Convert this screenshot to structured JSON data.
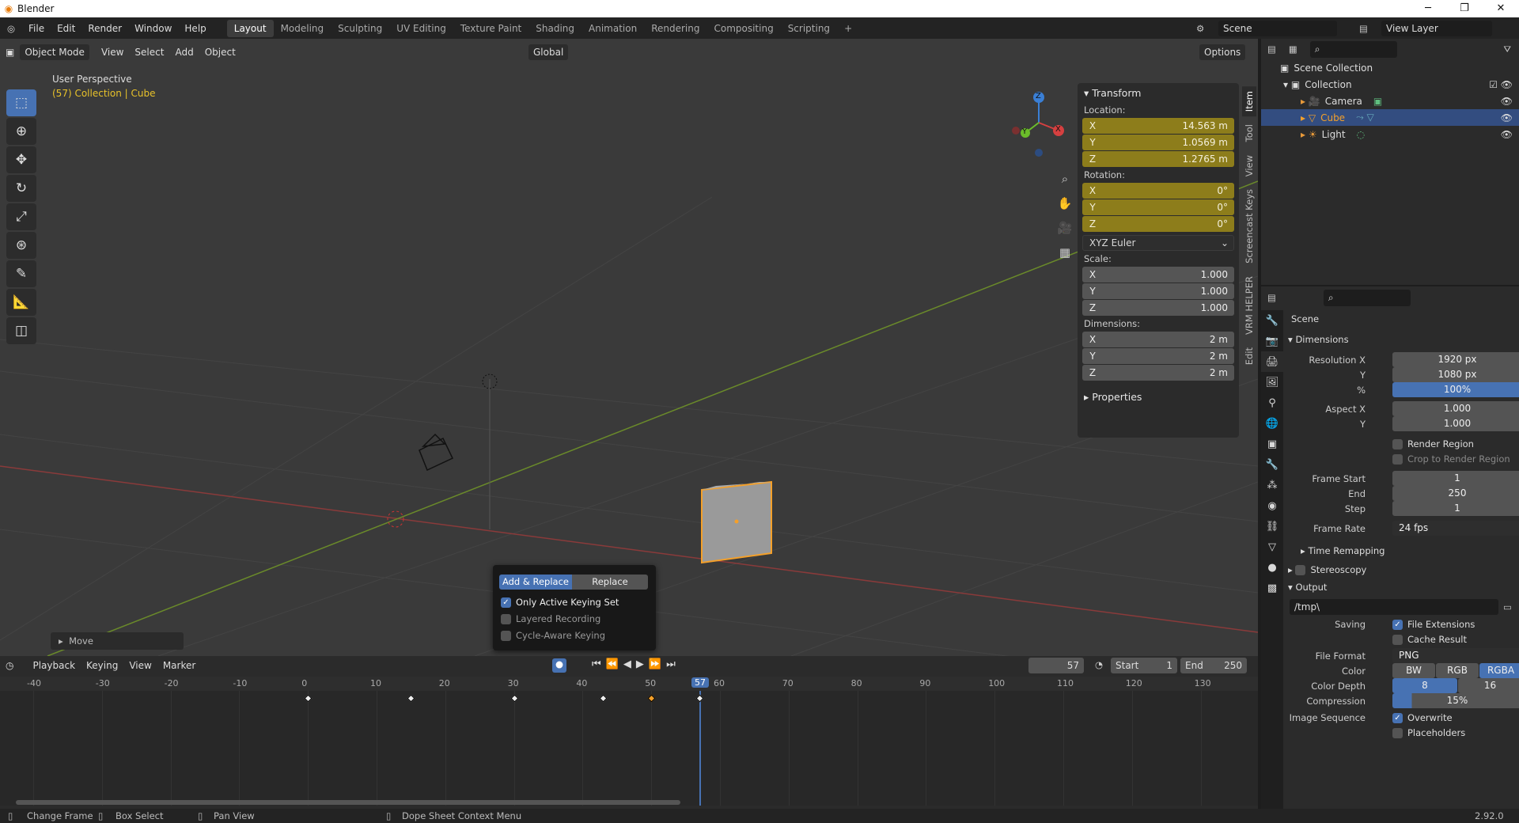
{
  "window": {
    "title": "Blender"
  },
  "menu": [
    "File",
    "Edit",
    "Render",
    "Window",
    "Help"
  ],
  "workspaces": [
    "Layout",
    "Modeling",
    "Sculpting",
    "UV Editing",
    "Texture Paint",
    "Shading",
    "Animation",
    "Rendering",
    "Compositing",
    "Scripting"
  ],
  "active_workspace": "Layout",
  "scene_field": "Scene",
  "view_layer_field": "View Layer",
  "viewport": {
    "mode": "Object Mode",
    "menus": [
      "View",
      "Select",
      "Add",
      "Object"
    ],
    "orientation": "Global",
    "options": "Options",
    "info_line1": "User Perspective",
    "info_line2": "(57) Collection | Cube",
    "move_panel": "Move",
    "gizmo_axes": {
      "x": "X",
      "y": "Y",
      "z": "Z"
    }
  },
  "npanel": {
    "header": "Transform",
    "location_label": "Location:",
    "location": [
      {
        "axis": "X",
        "value": "14.563 m"
      },
      {
        "axis": "Y",
        "value": "1.0569 m"
      },
      {
        "axis": "Z",
        "value": "1.2765 m"
      }
    ],
    "rotation_label": "Rotation:",
    "rotation": [
      {
        "axis": "X",
        "value": "0°"
      },
      {
        "axis": "Y",
        "value": "0°"
      },
      {
        "axis": "Z",
        "value": "0°"
      }
    ],
    "rotation_mode": "XYZ Euler",
    "scale_label": "Scale:",
    "scale": [
      {
        "axis": "X",
        "value": "1.000"
      },
      {
        "axis": "Y",
        "value": "1.000"
      },
      {
        "axis": "Z",
        "value": "1.000"
      }
    ],
    "dimensions_label": "Dimensions:",
    "dimensions": [
      {
        "axis": "X",
        "value": "2 m"
      },
      {
        "axis": "Y",
        "value": "2 m"
      },
      {
        "axis": "Z",
        "value": "2 m"
      }
    ],
    "properties_header": "Properties",
    "tabs": [
      "Item",
      "Tool",
      "View",
      "Screencast Keys",
      "VRM HELPER",
      "Edit"
    ]
  },
  "keying_popup": {
    "add_replace": "Add & Replace",
    "replace": "Replace",
    "opt1": "Only Active Keying Set",
    "opt2": "Layered Recording",
    "opt3": "Cycle-Aware Keying"
  },
  "timeline": {
    "menus": [
      "Playback",
      "Keying",
      "View",
      "Marker"
    ],
    "current_frame": "57",
    "start_label": "Start",
    "start": "1",
    "end_label": "End",
    "end": "250",
    "ruler": [
      "-40",
      "-30",
      "-20",
      "-10",
      "0",
      "10",
      "20",
      "30",
      "40",
      "50",
      "60",
      "70",
      "80",
      "90",
      "100",
      "110",
      "120",
      "130"
    ],
    "playhead_label": "57",
    "keyframes": [
      0,
      15,
      30,
      43,
      50,
      57
    ]
  },
  "outliner": {
    "root": "Scene Collection",
    "collection": "Collection",
    "items": [
      "Camera",
      "Cube",
      "Light"
    ]
  },
  "properties": {
    "scene": "Scene",
    "dimensions_header": "Dimensions",
    "res_x_label": "Resolution X",
    "res_x": "1920 px",
    "res_y_label": "Y",
    "res_y": "1080 px",
    "pct_label": "%",
    "pct": "100%",
    "aspect_x_label": "Aspect X",
    "aspect_x": "1.000",
    "aspect_y_label": "Y",
    "aspect_y": "1.000",
    "render_region": "Render Region",
    "crop_region": "Crop to Render Region",
    "frame_start_label": "Frame Start",
    "frame_start": "1",
    "end_label": "End",
    "end": "250",
    "step_label": "Step",
    "step": "1",
    "frame_rate_label": "Frame Rate",
    "frame_rate": "24 fps",
    "time_remap": "Time Remapping",
    "stereoscopy": "Stereoscopy",
    "output_header": "Output",
    "output_path": "/tmp\\",
    "saving_label": "Saving",
    "file_ext": "File Extensions",
    "cache_result": "Cache Result",
    "file_format_label": "File Format",
    "file_format": "PNG",
    "color_label": "Color",
    "color_opts": [
      "BW",
      "RGB",
      "RGBA"
    ],
    "depth_label": "Color Depth",
    "depth_opts": [
      "8",
      "16"
    ],
    "compression_label": "Compression",
    "compression": "15%",
    "img_seq_label": "Image Sequence",
    "overwrite": "Overwrite",
    "placeholders": "Placeholders"
  },
  "status": {
    "a": "Change Frame",
    "b": "Box Select",
    "c": "Pan View",
    "d": "Dope Sheet Context Menu",
    "version": "2.92.0"
  },
  "colors": {
    "accent": "#4772b3",
    "selected_orange": "#f4a02a",
    "gold_field": "#8d7d1b"
  }
}
